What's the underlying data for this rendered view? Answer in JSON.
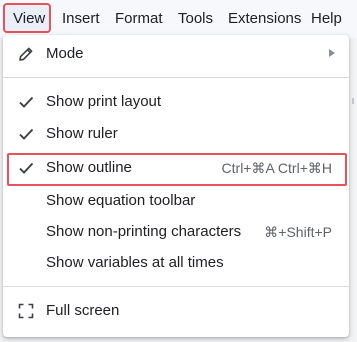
{
  "menubar": {
    "items": [
      {
        "label": "View",
        "active": true
      },
      {
        "label": "Insert"
      },
      {
        "label": "Format"
      },
      {
        "label": "Tools"
      },
      {
        "label": "Extensions"
      },
      {
        "label": "Help"
      }
    ]
  },
  "dropdown": {
    "mode": {
      "label": "Mode",
      "icon": "pencil-icon",
      "has_submenu": true
    },
    "checked_items": [
      {
        "label": "Show print layout",
        "checked": true
      },
      {
        "label": "Show ruler",
        "checked": true
      },
      {
        "label": "Show outline",
        "checked": true,
        "shortcut": "Ctrl+⌘A Ctrl+⌘H",
        "highlighted": true
      }
    ],
    "unchecked_items": [
      {
        "label": "Show equation toolbar"
      },
      {
        "label": "Show non-printing characters",
        "shortcut": "⌘+Shift+P"
      },
      {
        "label": "Show variables at all times"
      }
    ],
    "fullscreen": {
      "label": "Full screen",
      "icon": "fullscreen-icon"
    }
  },
  "colors": {
    "highlight_border": "#e8525a",
    "menu_bg": "#ffffff",
    "text": "#202124",
    "muted": "#5f6368"
  }
}
